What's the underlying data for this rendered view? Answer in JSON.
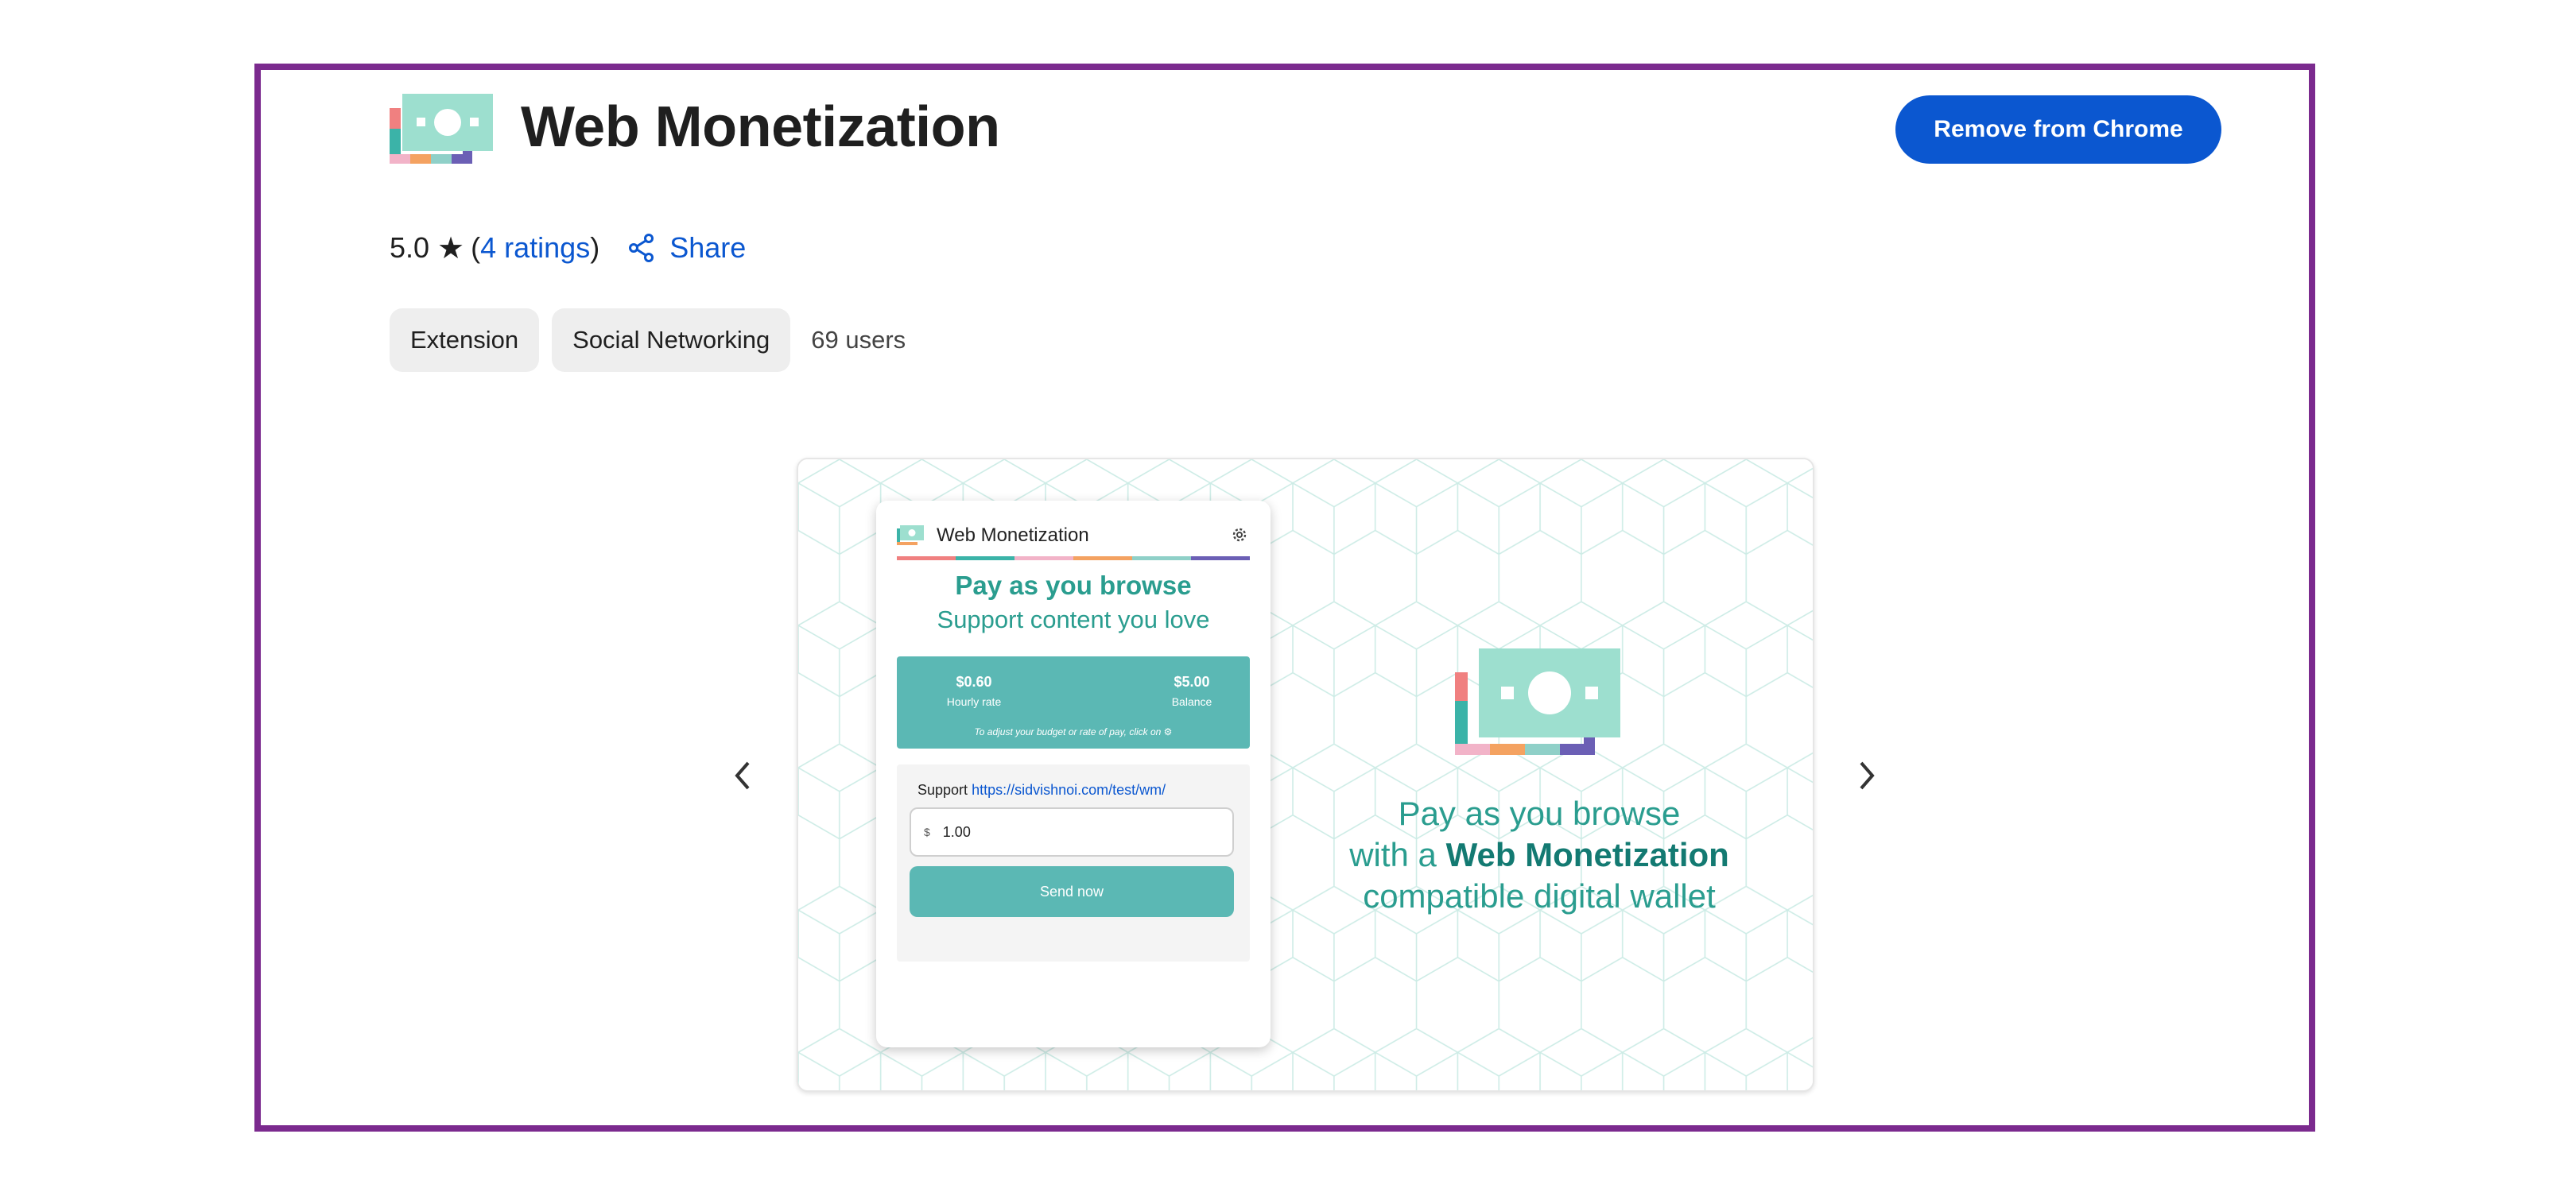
{
  "header": {
    "title": "Web Monetization",
    "remove_button": "Remove from Chrome"
  },
  "rating": {
    "score": "5.0",
    "star": "★",
    "open_paren": "(",
    "ratings_link": "4 ratings",
    "close_paren": ")",
    "share_label": "Share"
  },
  "chips": {
    "type": "Extension",
    "category": "Social Networking",
    "users": "69 users"
  },
  "slide": {
    "popup": {
      "title": "Web Monetization",
      "headline": "Pay as you browse",
      "subheadline": "Support content you love",
      "hourly_value": "$0.60",
      "hourly_label": "Hourly rate",
      "balance_value": "$5.00",
      "balance_label": "Balance",
      "note": "To adjust your budget or rate of pay, click on ⚙",
      "support_label": "Support",
      "support_url": "https://sidvishnoi.com/test/wm/",
      "currency": "$",
      "amount": "1.00",
      "send_button": "Send now"
    },
    "promo": {
      "line1": "Pay as you browse",
      "line2_prefix": "with a ",
      "line2_bold": "Web Monetization",
      "line3": "compatible digital wallet"
    }
  },
  "colors": {
    "frame": "#7b2a8e",
    "primary": "#0b57d0",
    "teal": "#2a9d8f",
    "mint": "#8fdcc8"
  },
  "icons": [
    "app-logo-icon",
    "star-icon",
    "share-icon",
    "chevron-left-icon",
    "chevron-right-icon",
    "gear-icon"
  ]
}
